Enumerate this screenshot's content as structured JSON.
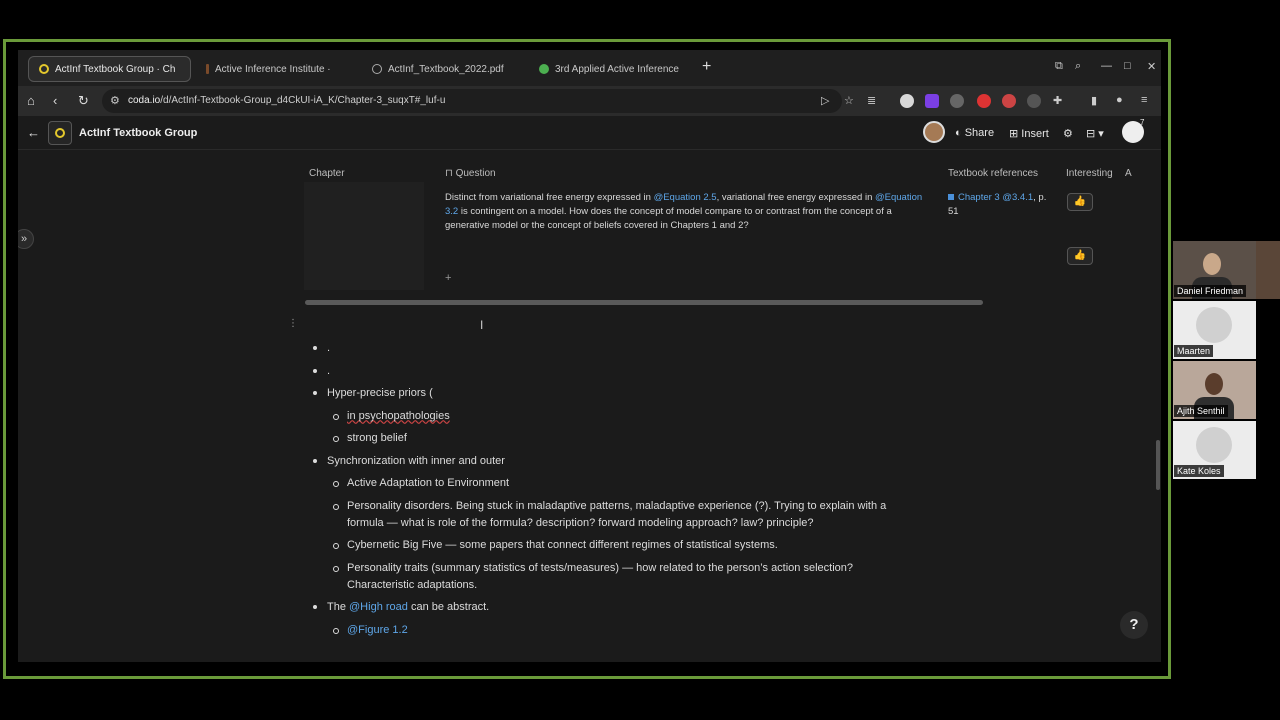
{
  "browser": {
    "tabs": [
      {
        "label": "ActInf Textbook Group · Ch",
        "icon_color": "#e4c82c",
        "active": true
      },
      {
        "label": "Active Inference Institute ·",
        "icon_color": "#7a4a2a",
        "active": false
      },
      {
        "label": "ActInf_Textbook_2022.pdf",
        "icon_color": "#888888",
        "active": false
      },
      {
        "label": "3rd Applied Active Inference",
        "icon_color": "#4caf50",
        "active": false
      }
    ],
    "new_tab": "+",
    "url_host": "coda.io",
    "url_path": "/d/ActInf-Textbook-Group_d4CkUI-iA_K/Chapter-3_suqxT#_luf-u"
  },
  "app": {
    "title": "ActInf Textbook Group",
    "share": "Share",
    "insert": "Insert",
    "avatar_count": "7"
  },
  "table": {
    "headers": [
      "Chapter",
      "Question",
      "Textbook references",
      "Interesting",
      "A"
    ],
    "row": {
      "q_pre": "Distinct from variational free energy expressed in ",
      "q_link1": "@Equation 2.5",
      "q_mid": ", variational free energy expressed in ",
      "q_link2": "@Equation 3.2",
      "q_post": " is contingent on a model.  How does the concept of model compare to or contrast from the concept of a generative model or the concept of beliefs covered in Chapters 1 and 2?",
      "ref_link": "Chapter 3 @3.4.1",
      "ref_tail": ", p. 51"
    },
    "add_row": "+"
  },
  "bullets": {
    "b1": ".",
    "b2": ".",
    "b3": "Hyper-precise priors (",
    "b3a": "in psychopathologies",
    "b3b": "strong belief",
    "b4": "Synchronization with inner and outer",
    "b4a": "Active Adaptation to Environment",
    "b4b": "Personality disorders. Being stuck in maladaptive patterns, maladaptive experience (?). Trying to explain with a formula — what is role of the formula? description? forward modeling approach? law? principle?",
    "b4c": "Cybernetic Big Five — some papers that connect different regimes of statistical systems.",
    "b4d": "Personality traits (summary statistics of tests/measures) — how related to the person’s action selection? Characteristic adaptations.",
    "b5_pre": "The ",
    "b5_link": "@High road",
    "b5_post": " can be abstract.",
    "b5a_link": "@Figure 1.2"
  },
  "participants": [
    "Daniel Friedman",
    "Maarten",
    "Ajith Senthil",
    "Kate Koles"
  ],
  "help": "?"
}
